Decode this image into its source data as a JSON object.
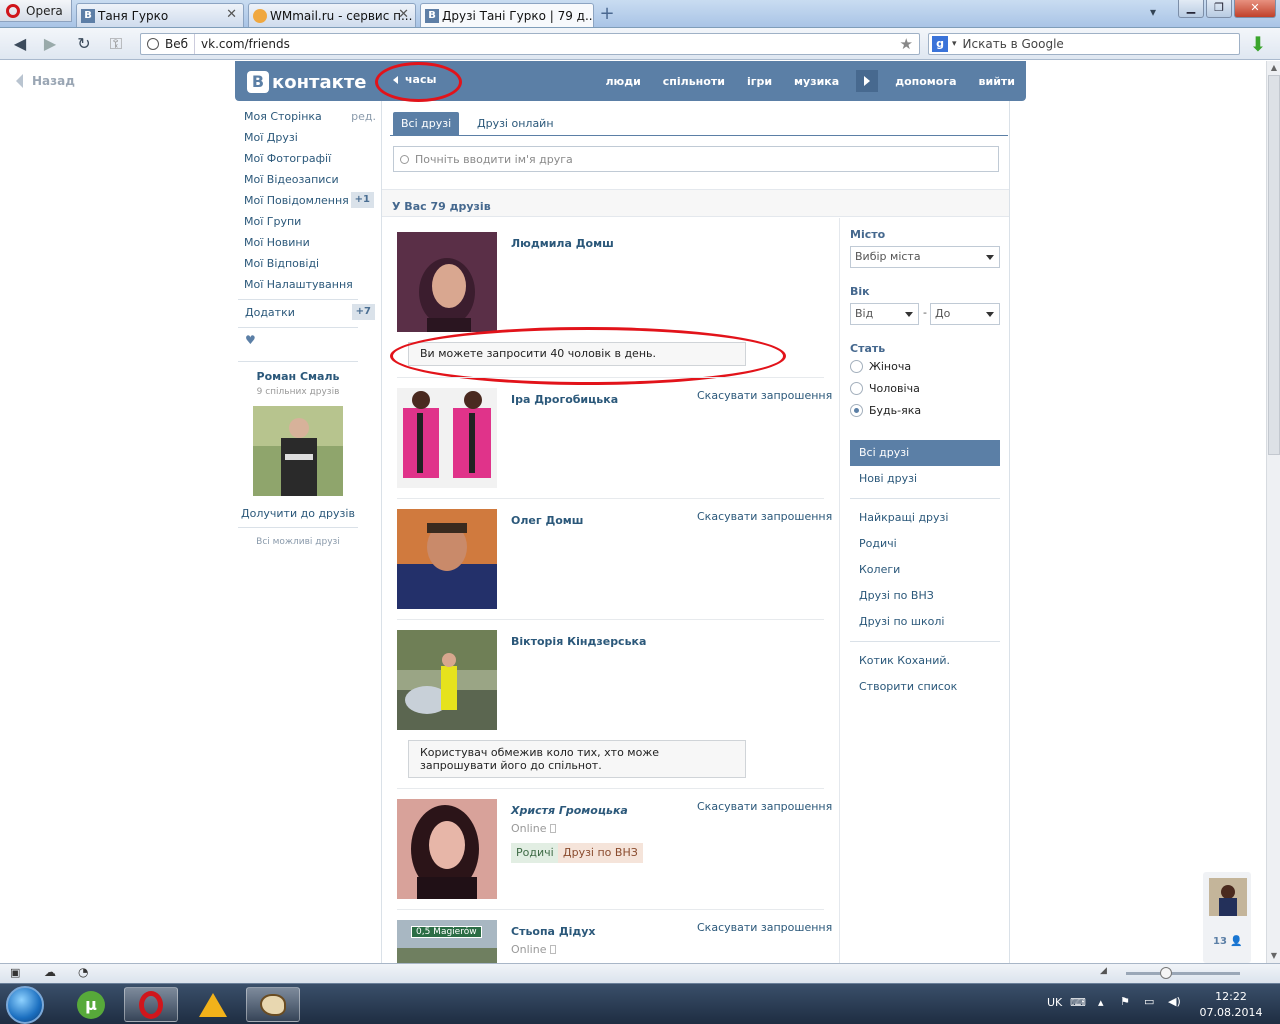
{
  "browser": {
    "app_name": "Opera",
    "tabs": [
      {
        "label": "Таня Гурко",
        "icon": "vk-icon"
      },
      {
        "label": "WMmail.ru - сервис п...",
        "icon": "wmmail-icon"
      },
      {
        "label": "Друзі Тані Гурко | 79 д...",
        "icon": "vk-icon"
      }
    ],
    "address_scope": "Веб",
    "url": "vk.com/friends",
    "search_placeholder": "Искать в Google"
  },
  "page": {
    "back_label": "Назад",
    "logo_text": "контакте",
    "logo_letter": "В",
    "player_label": "часы",
    "topnav": [
      "люди",
      "спільноти",
      "ігри",
      "музика",
      "допомога",
      "вийти"
    ]
  },
  "left_menu": {
    "items": [
      {
        "label": "Моя Сторінка",
        "extra": "ред."
      },
      {
        "label": "Мої Друзі"
      },
      {
        "label": "Мої Фотографії"
      },
      {
        "label": "Мої Відеозаписи"
      },
      {
        "label": "Мої Повідомлення",
        "count": "+1"
      },
      {
        "label": "Мої Групи"
      },
      {
        "label": "Мої Новини"
      },
      {
        "label": "Мої Відповіді"
      },
      {
        "label": "Мої Налаштування"
      }
    ],
    "apps_label": "Додатки",
    "apps_count": "+7",
    "heart": "♥",
    "suggest_name": "Роман Смаль",
    "suggest_mutual": "9 спільних друзів",
    "suggest_add": "Долучити до друзів",
    "suggest_all": "Всі можливі друзі"
  },
  "center": {
    "tab_all": "Всі друзі",
    "tab_online": "Друзі онлайн",
    "search_placeholder": "Почніть вводити ім'я друга",
    "summary": "У Вас 79 друзів",
    "tip1": "Ви можете запросити 40 чоловік в день.",
    "tip2": "Користувач обмежив коло тих, хто може запрошувати його до спільнот.",
    "friends": [
      {
        "name": "Людмила Домш",
        "photo_color": "#6a3a55"
      },
      {
        "name": "Іра Дрогобицька",
        "action": "Скасувати запрошення",
        "photo_color": "#e0338a"
      },
      {
        "name": "Олег Домш",
        "action": "Скасувати запрошення",
        "photo_color": "#c9683a"
      },
      {
        "name": "Вікторія Кіндзерська",
        "photo_color": "#7d8b62"
      },
      {
        "name": "Христя Громоцька",
        "action": "Скасувати запрошення",
        "online": "Online",
        "lists": [
          "Родичі",
          "Друзі по ВНЗ"
        ],
        "photo_color": "#b5505a"
      },
      {
        "name": "Стьопа Дідух",
        "action": "Скасувати запрошення",
        "online": "Online",
        "photo_color": "#8a9aa6",
        "sign_text": "0,5 Magierów"
      }
    ]
  },
  "filters": {
    "city_label": "Місто",
    "city_value": "Вибір міста",
    "age_label": "Вік",
    "age_from": "Від",
    "age_dash": "-",
    "age_to": "До",
    "sex_label": "Стать",
    "sex_options": [
      "Жіноча",
      "Чоловіча",
      "Будь-яка"
    ],
    "sex_selected": "Будь-яка",
    "menu_main": [
      "Всі друзі",
      "Нові друзі"
    ],
    "menu_lists": [
      "Найкращі друзі",
      "Родичі",
      "Колеги",
      "Друзі по ВНЗ",
      "Друзі по школі"
    ],
    "menu_custom": [
      "Котик Коханий.",
      "Створити список"
    ]
  },
  "side_widget": {
    "count": "13"
  },
  "taskbar": {
    "lang": "UK",
    "time": "12:22",
    "date": "07.08.2014"
  },
  "colors": {
    "vk_blue": "#5b7fa6",
    "link": "#2b587a",
    "annotation_red": "#e2131a"
  }
}
